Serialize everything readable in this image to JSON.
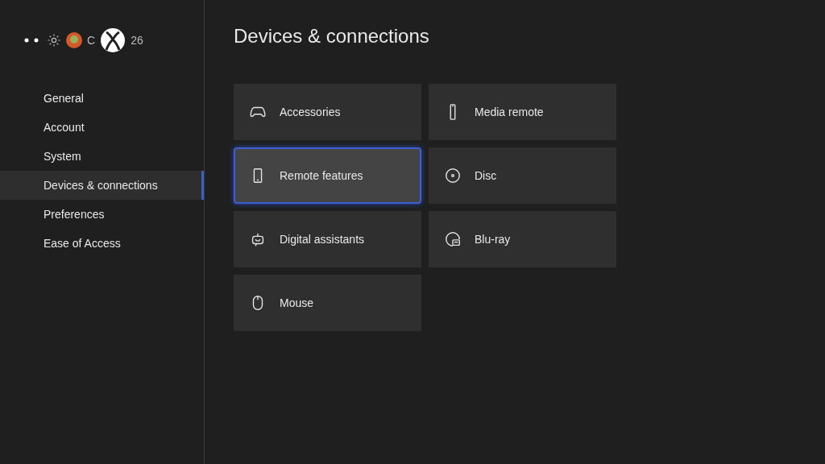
{
  "header": {
    "user_name_start": "C",
    "user_name_end": "26"
  },
  "sidebar": {
    "items": [
      {
        "label": "General",
        "selected": false
      },
      {
        "label": "Account",
        "selected": false
      },
      {
        "label": "System",
        "selected": false
      },
      {
        "label": "Devices & connections",
        "selected": true
      },
      {
        "label": "Preferences",
        "selected": false
      },
      {
        "label": "Ease of Access",
        "selected": false
      }
    ]
  },
  "page": {
    "title": "Devices & connections"
  },
  "tiles": [
    {
      "label": "Accessories",
      "kind": "controller",
      "selected": false
    },
    {
      "label": "Media remote",
      "kind": "remote",
      "selected": false
    },
    {
      "label": "Remote features",
      "kind": "phone",
      "selected": true
    },
    {
      "label": "Disc",
      "kind": "disc",
      "selected": false
    },
    {
      "label": "Digital assistants",
      "kind": "assistant",
      "selected": false
    },
    {
      "label": "Blu-ray",
      "kind": "bluray",
      "selected": false
    },
    {
      "label": "Mouse",
      "kind": "mouse",
      "selected": false
    }
  ]
}
